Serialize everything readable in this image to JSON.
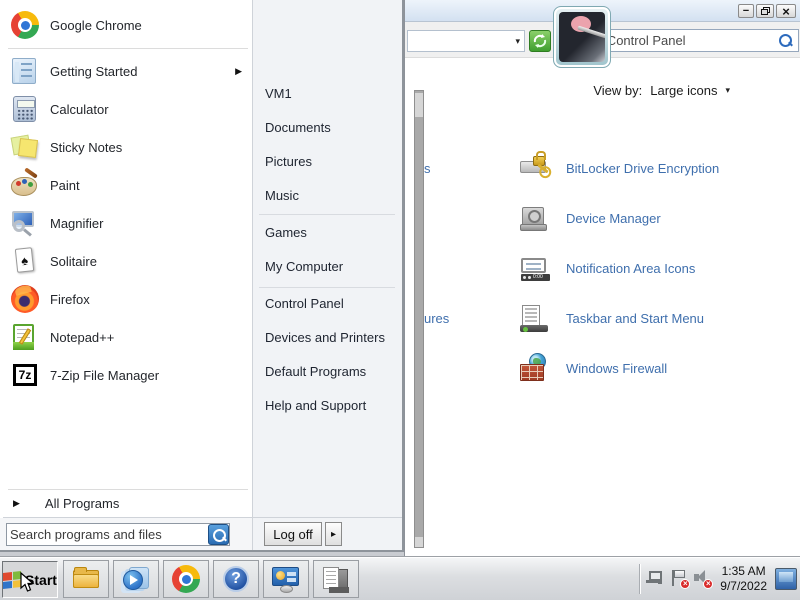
{
  "colors": {
    "cp_link": "#3f6fad",
    "menu_text": "#23262b",
    "right_panel_bg": "#f1f3f6",
    "titlebar_top": "#eef4fb",
    "search_button_blue": "#2a6cb3",
    "refresh_green": "#3f9e2f"
  },
  "glyphs": {
    "submenu_arrow": "▶",
    "all_programs_arrow": "▶",
    "logoff_arrow": "▸",
    "dropdown_arrow": "▾",
    "minimize": "−",
    "close": "×",
    "help_question": "?",
    "spade": "♠",
    "sevenzip_text": "7z"
  },
  "start_menu": {
    "left_items": [
      {
        "label": "Google Chrome",
        "icon": "chrome-icon"
      },
      {
        "label": "Getting Started",
        "icon": "getting-started-icon",
        "has_submenu": true
      },
      {
        "label": "Calculator",
        "icon": "calculator-icon"
      },
      {
        "label": "Sticky Notes",
        "icon": "sticky-notes-icon"
      },
      {
        "label": "Paint",
        "icon": "paint-icon"
      },
      {
        "label": "Magnifier",
        "icon": "magnifier-icon"
      },
      {
        "label": "Solitaire",
        "icon": "solitaire-icon"
      },
      {
        "label": "Firefox",
        "icon": "firefox-icon"
      },
      {
        "label": "Notepad++",
        "icon": "notepadpp-icon"
      },
      {
        "label": "7-Zip File Manager",
        "icon": "7zip-icon"
      }
    ],
    "all_programs_label": "All Programs",
    "search_placeholder": "Search programs and files",
    "user_name": "VM1",
    "right_group1": [
      "Documents",
      "Pictures",
      "Music"
    ],
    "right_group2": [
      "Games",
      "My Computer"
    ],
    "right_group3": [
      "Control Panel",
      "Devices and Printers",
      "Default Programs",
      "Help and Support"
    ],
    "log_off_label": "Log off"
  },
  "control_panel_window": {
    "search_placeholder": "Search Control Panel",
    "view_by_label": "View by:",
    "view_by_value": "Large icons",
    "items": [
      {
        "label": "BitLocker Drive Encryption",
        "icon": "bitlocker-icon"
      },
      {
        "label": "Device Manager",
        "icon": "device-manager-icon"
      },
      {
        "label": "Notification Area Icons",
        "icon": "notification-area-icon"
      },
      {
        "label": "Taskbar and Start Menu",
        "icon": "taskbar-startmenu-icon"
      },
      {
        "label": "Windows Firewall",
        "icon": "firewall-icon"
      }
    ],
    "clipped_labels": [
      "s",
      "ures"
    ]
  },
  "taskbar": {
    "start_label": "Start",
    "buttons": [
      "explorer-icon",
      "media-player-icon",
      "chrome-icon",
      "help-icon",
      "display-settings-icon",
      "system-tools-icon"
    ],
    "tray_time": "1:35 AM",
    "tray_date": "9/7/2022"
  }
}
